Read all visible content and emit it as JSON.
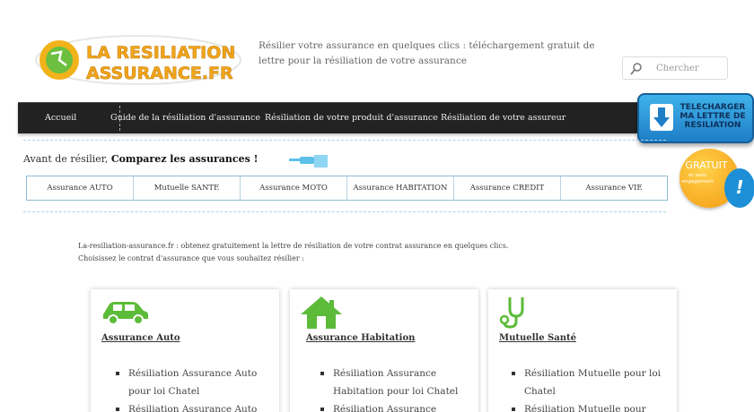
{
  "header": {
    "logo_line1": "LA RESILIATION",
    "logo_line2": "ASSURANCE.FR",
    "tagline": "Résilier votre assurance en quelques clics : téléchargement gratuit de lettre pour la résiliation de votre assurance",
    "search_placeholder": "Chercher"
  },
  "nav": {
    "items": [
      "Accueil",
      "Guide de la résiliation d'assurance",
      "Résiliation de votre produit d'assurance",
      "Résiliation de votre assureur"
    ]
  },
  "badge": {
    "line1": "TELECHARGER",
    "line2": "MA LETTRE DE",
    "line3": "RESILIATION",
    "gratuit": "GRATUIT",
    "gratuit_sub": "et sans engagement",
    "excl": "!"
  },
  "compare": {
    "prefix": "Avant de résilier, ",
    "bold": "Comparez les assurances !"
  },
  "tabs": [
    "Assurance AUTO",
    "Mutuelle SANTE",
    "Assurance MOTO",
    "Assurance HABITATION",
    "Assurance CREDIT",
    "Assurance VIE"
  ],
  "intro": {
    "line1": "La-resiliation-assurance.fr : obtenez gratuitement la lettre de résiliation de votre contrat assurance en quelques clics.",
    "line2": "Choisissez le contrat d'assurance que vous souhaitez résilier :"
  },
  "cards": [
    {
      "title": "Assurance Auto",
      "icon": "car-icon",
      "items": [
        "Résiliation Assurance Auto pour loi Chatel",
        "Résiliation Assurance Auto"
      ]
    },
    {
      "title": "Assurance Habitation",
      "icon": "house-icon",
      "items": [
        "Résiliation Assurance Habitation pour loi Chatel",
        "Résiliation Assurance"
      ]
    },
    {
      "title": "Mutuelle Santé",
      "icon": "stethoscope-icon",
      "items": [
        "Résiliation Mutuelle pour loi Chatel",
        "Résiliation Mutuelle pour"
      ]
    }
  ],
  "colors": {
    "accent_green": "#5dbb3a",
    "nav_bg": "#222222",
    "badge_blue": "#1e7fc7",
    "gratuit_orange": "#f39a12"
  }
}
